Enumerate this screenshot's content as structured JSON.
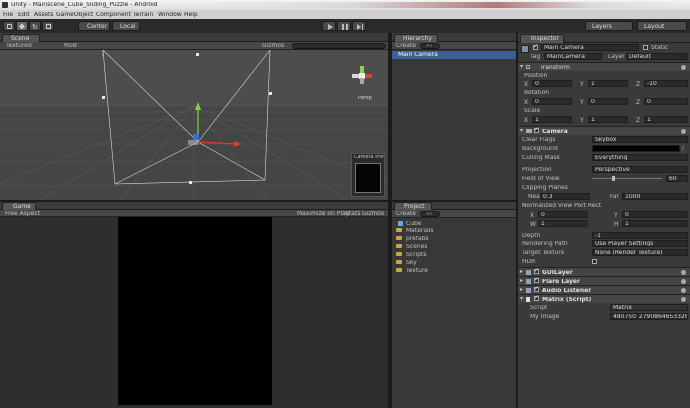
{
  "window": {
    "title": "Unity - Mainscene_Cube_Sliding_Puzzle - Android"
  },
  "menu": [
    "File",
    "Edit",
    "Assets",
    "GameObject",
    "Component",
    "Terrain",
    "Window",
    "Help"
  ],
  "toolbar": {
    "pivot": "Center",
    "space": "Local",
    "layers": "Layers",
    "layout": "Layout"
  },
  "scene": {
    "tab": "Scene",
    "render_mode": "Textured",
    "color_mode": "RGB",
    "gizmos": "Gizmos",
    "persp_label": "Persp",
    "preview_title": "Camera Preview"
  },
  "game": {
    "tab": "Game",
    "aspect": "Free Aspect",
    "stats_left": "Maximize on Play",
    "stats_mid": "Stats",
    "stats_right": "Gizmos"
  },
  "hierarchy": {
    "tab": "Hierarchy",
    "create": "Create",
    "search_placeholder": "All",
    "items": [
      "Main Camera"
    ]
  },
  "project": {
    "tab": "Project",
    "create": "Create",
    "search_placeholder": "All",
    "items": [
      "Cube",
      "Materials",
      "prefabs",
      "Scenes",
      "Scripts",
      "Sky",
      "Texture"
    ]
  },
  "inspector": {
    "tab": "Inspector",
    "object_name": "Main Camera",
    "static_label": "Static",
    "tag_label": "Tag",
    "tag_value": "MainCamera",
    "layer_label": "Layer",
    "layer_value": "Default",
    "transform": {
      "title": "Transform",
      "position_label": "Position",
      "position": {
        "x": "0",
        "y": "1",
        "z": "-10"
      },
      "rotation_label": "Rotation",
      "rotation": {
        "x": "0",
        "y": "0",
        "z": "0"
      },
      "scale_label": "Scale",
      "scale": {
        "x": "1",
        "y": "1",
        "z": "1"
      }
    },
    "camera": {
      "title": "Camera",
      "clear_flags_label": "Clear Flags",
      "clear_flags_value": "Skybox",
      "background_label": "Background",
      "culling_mask_label": "Culling Mask",
      "culling_mask_value": "Everything",
      "projection_label": "Projection",
      "projection_value": "Perspective",
      "fov_label": "Field of View",
      "fov_value": "60",
      "clipping_label": "Clipping Planes",
      "near_label": "Near",
      "near_value": "0.3",
      "far_label": "Far",
      "far_value": "1000",
      "viewport_label": "Normalized View Port Rect",
      "vp_x": "0",
      "vp_y": "0",
      "vp_w": "1",
      "vp_h": "1",
      "depth_label": "Depth",
      "depth_value": "-1",
      "rendering_path_label": "Rendering Path",
      "rendering_path_value": "Use Player Settings",
      "target_texture_label": "Target Texture",
      "target_texture_value": "None (Render Texture)",
      "hdr_label": "HDR"
    },
    "components": [
      "GUILayer",
      "Flare Layer",
      "Audio Listener",
      "Matrix (Script)"
    ],
    "script_label": "Script",
    "script_value": "Matrix",
    "my_image_label": "My Image",
    "my_image_value": "480750_2790864653326"
  },
  "colors": {
    "background": "#383838",
    "scene_bg": "#454545",
    "gizmo_y": "#8ad04a",
    "gizmo_x": "#d9412b",
    "gizmo_z": "#3c6ed8"
  }
}
